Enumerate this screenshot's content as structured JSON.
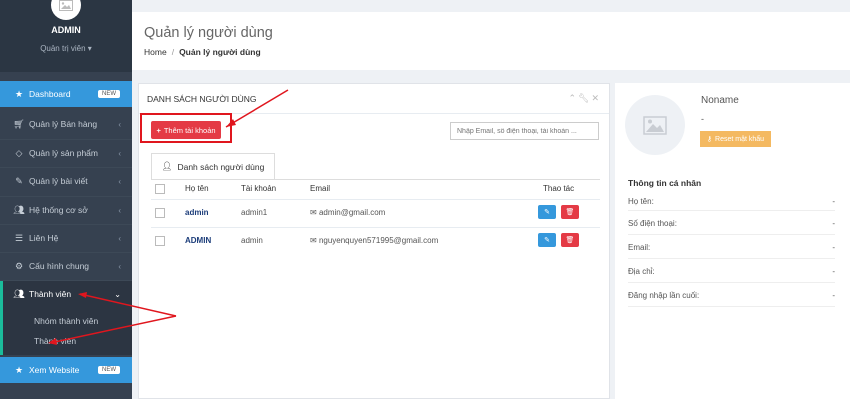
{
  "sidebar": {
    "profile": {
      "name": "ADMIN",
      "role": "Quản trị viên"
    },
    "items": [
      {
        "label": "Dashboard",
        "icon": "star-icon",
        "badge": "NEW"
      },
      {
        "label": "Quản lý Bán hàng",
        "icon": "cart-icon"
      },
      {
        "label": "Quản lý sản phẩm",
        "icon": "diamond-icon"
      },
      {
        "label": "Quản lý bài viết",
        "icon": "edit-icon"
      },
      {
        "label": "Hệ thống cơ sở",
        "icon": "users-icon"
      },
      {
        "label": "Liên Hệ",
        "icon": "list-icon"
      },
      {
        "label": "Cấu hình chung",
        "icon": "gear-icon"
      },
      {
        "label": "Thành viên",
        "icon": "user-group-icon"
      },
      {
        "label": "Xem Website",
        "icon": "star-icon",
        "badge": "NEW"
      }
    ],
    "submenu": [
      "Nhóm thành viên",
      "Thành viên"
    ]
  },
  "header": {
    "title": "Quản lý người dùng",
    "breadcrumb": [
      "Home",
      "Quản lý người dùng"
    ]
  },
  "panel": {
    "title": "DANH SÁCH NGƯỜI DÙNG",
    "add_button": "Thêm tài khoản",
    "search_placeholder": "Nhập Email, số điện thoại, tài khoản ...",
    "tab": "Danh sách người dùng",
    "columns": [
      "Họ tên",
      "Tài khoản",
      "Email",
      "Thao tác"
    ],
    "rows": [
      {
        "name": "admin",
        "account": "admin1",
        "email": "admin@gmail.com"
      },
      {
        "name": "ADMIN",
        "account": "admin",
        "email": "nguyenquyen571995@gmail.com"
      }
    ]
  },
  "profile_panel": {
    "name": "Noname",
    "sub": "-",
    "reset_button": "Reset mật khẩu",
    "info_title": "Thông tin cá nhân",
    "fields": [
      {
        "label": "Họ tên:",
        "value": "-"
      },
      {
        "label": "Số điện thoại:",
        "value": "-"
      },
      {
        "label": "Email:",
        "value": "-"
      },
      {
        "label": "Địa chỉ:",
        "value": "-"
      },
      {
        "label": "Đăng nhập lần cuối:",
        "value": "-"
      }
    ]
  },
  "colors": {
    "accent": "#3598dc",
    "danger": "#e43a45",
    "warning": "#f4b961",
    "sidebar": "#364150",
    "annotation": "#e0161e"
  }
}
